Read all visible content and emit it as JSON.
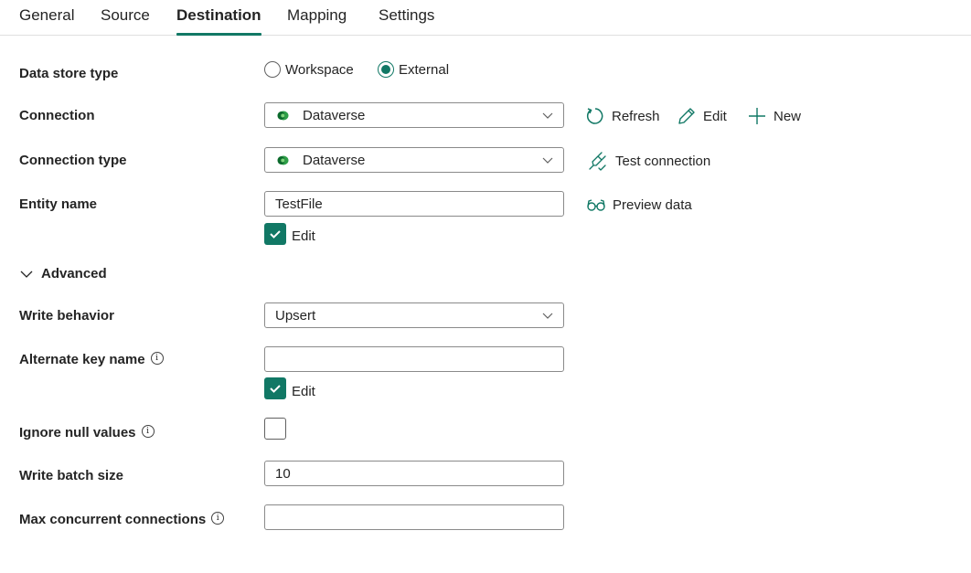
{
  "tabs": [
    {
      "label": "General",
      "active": false
    },
    {
      "label": "Source",
      "active": false
    },
    {
      "label": "Destination",
      "active": true
    },
    {
      "label": "Mapping",
      "active": false
    },
    {
      "label": "Settings",
      "active": false
    }
  ],
  "form": {
    "data_store_type": {
      "label": "Data store type",
      "options": [
        {
          "label": "Workspace",
          "selected": false
        },
        {
          "label": "External",
          "selected": true
        }
      ]
    },
    "connection": {
      "label": "Connection",
      "value": "Dataverse",
      "icon": "dataverse-icon",
      "actions": {
        "refresh": "Refresh",
        "edit": "Edit",
        "new": "New"
      }
    },
    "connection_type": {
      "label": "Connection type",
      "value": "Dataverse",
      "icon": "dataverse-icon",
      "action": "Test connection"
    },
    "entity_name": {
      "label": "Entity name",
      "value": "TestFile",
      "action": "Preview data",
      "edit_label": "Edit",
      "edit_checked": true
    },
    "advanced": {
      "label": "Advanced",
      "expanded": true
    },
    "write_behavior": {
      "label": "Write behavior",
      "value": "Upsert"
    },
    "alternate_key_name": {
      "label": "Alternate key name",
      "value": "",
      "edit_label": "Edit",
      "edit_checked": true
    },
    "ignore_null_values": {
      "label": "Ignore null values",
      "checked": false
    },
    "write_batch_size": {
      "label": "Write batch size",
      "value": "10"
    },
    "max_concurrent_connections": {
      "label": "Max concurrent connections",
      "value": ""
    }
  },
  "colors": {
    "accent": "#117865",
    "text": "#242424",
    "border": "#8a8a8a"
  },
  "info_glyph": "i"
}
